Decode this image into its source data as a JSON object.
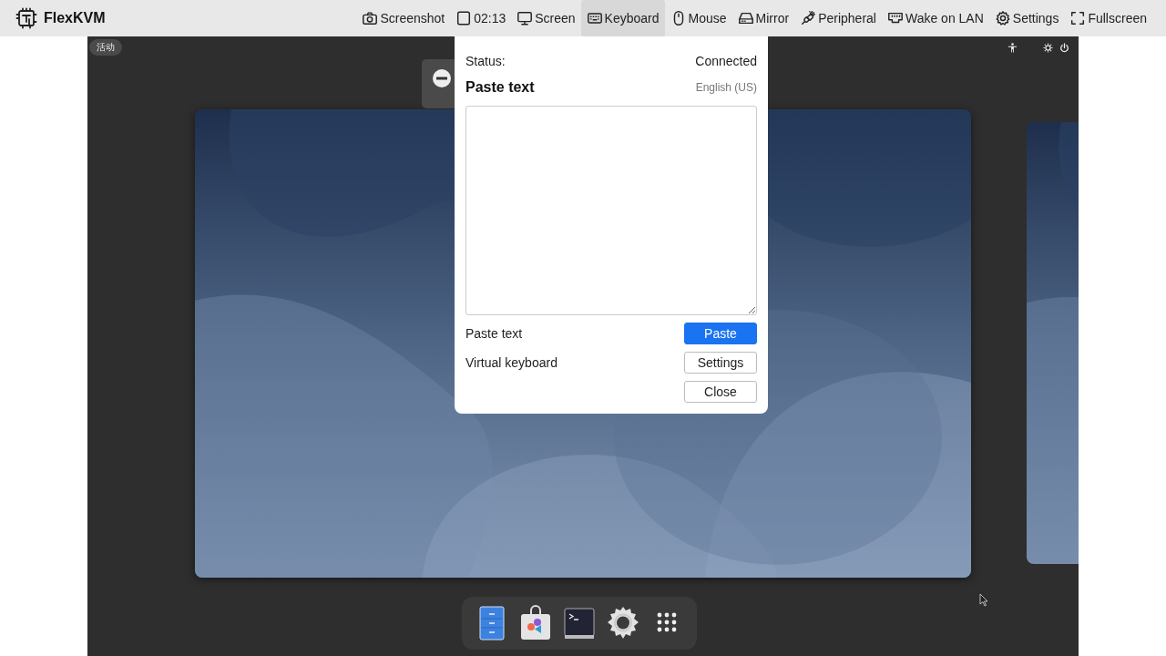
{
  "app": {
    "name": "FlexKVM"
  },
  "toolbar": [
    {
      "kind": "camera",
      "label": "Screenshot",
      "selected": false
    },
    {
      "kind": "square",
      "label": "02:13",
      "selected": false
    },
    {
      "kind": "monitor",
      "label": "Screen",
      "selected": false
    },
    {
      "kind": "keyboard",
      "label": "Keyboard",
      "selected": true
    },
    {
      "kind": "mouse",
      "label": "Mouse",
      "selected": false
    },
    {
      "kind": "drive",
      "label": "Mirror",
      "selected": false
    },
    {
      "kind": "plug",
      "label": "Peripheral",
      "selected": false
    },
    {
      "kind": "ethernet",
      "label": "Wake on LAN",
      "selected": false
    },
    {
      "kind": "gear",
      "label": "Settings",
      "selected": false
    },
    {
      "kind": "expand",
      "label": "Fullscreen",
      "selected": false
    }
  ],
  "remote": {
    "activities": "活动",
    "dock": [
      {
        "kind": "files"
      },
      {
        "kind": "store"
      },
      {
        "kind": "terminal"
      },
      {
        "kind": "settings"
      },
      {
        "kind": "apps"
      }
    ]
  },
  "keyboard_panel": {
    "status_label": "Status:",
    "status_value": "Connected",
    "title": "Paste text",
    "layout": "English (US)",
    "rows": [
      {
        "label": "Paste text",
        "button": "Paste",
        "kind": "primary"
      },
      {
        "label": "Virtual keyboard",
        "button": "Settings",
        "kind": "plain"
      },
      {
        "button": "Close",
        "kind": "plain"
      }
    ]
  }
}
